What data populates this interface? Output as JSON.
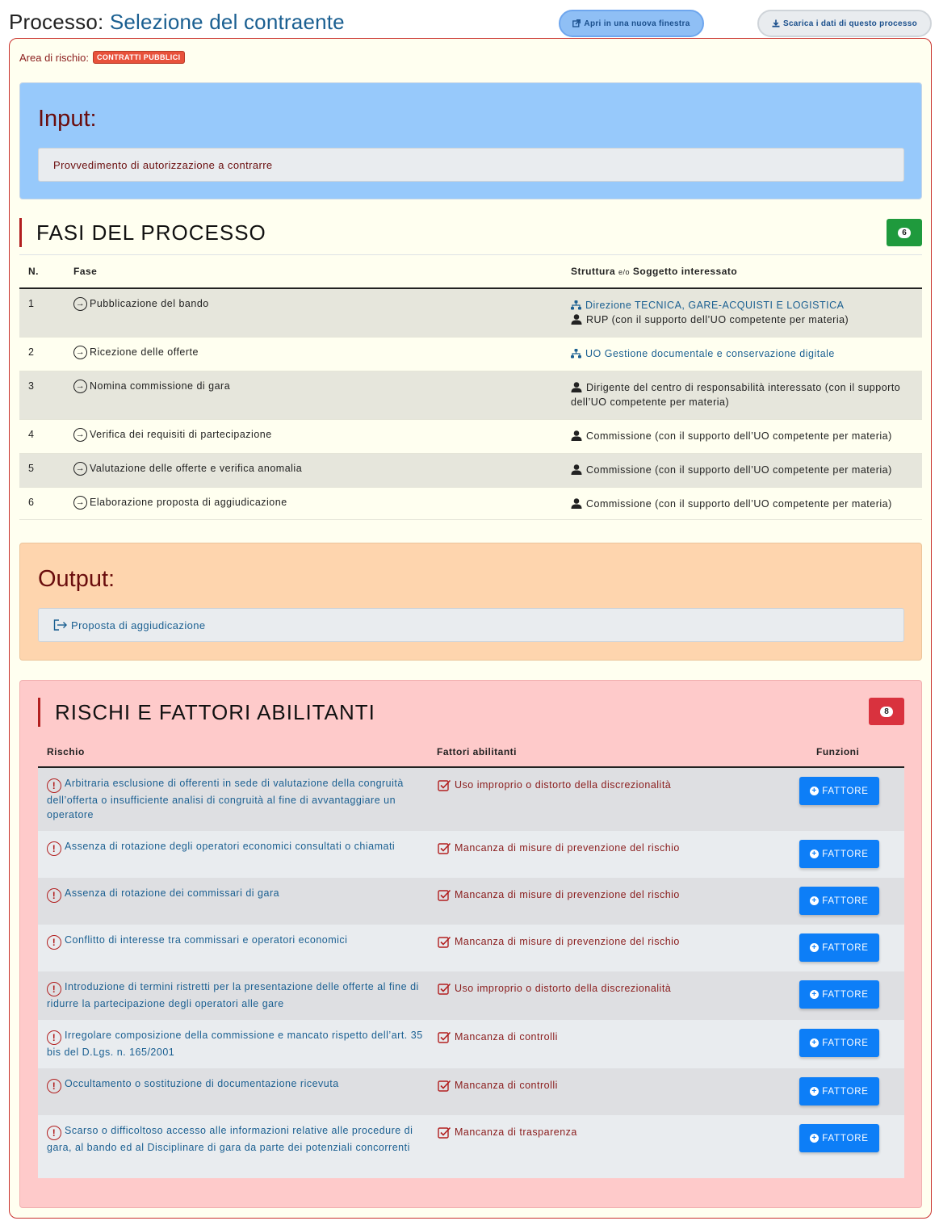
{
  "header": {
    "title_prefix": "Processo:",
    "process_name": "Selezione del contraente",
    "open_new_window_label": "Apri in una nuova finestra",
    "download_label": "Scarica i dati di questo processo"
  },
  "risk_area": {
    "label": "Area di rischio:",
    "value": "CONTRATTI PUBBLICI"
  },
  "input": {
    "title": "Input:",
    "value": "Provvedimento di autorizzazione a contrarre"
  },
  "phases": {
    "title": "FASI DEL PROCESSO",
    "count": "6",
    "col_n": "N.",
    "col_fase": "Fase",
    "col_struttura": "Struttura",
    "col_eo": "e/o",
    "col_soggetto": "Soggetto interessato",
    "rows": [
      {
        "n": "1",
        "fase": "Pubblicazione del bando",
        "org": "Direzione TECNICA, GARE-ACQUISTI E LOGISTICA",
        "person": "RUP (con il supporto dell’UO competente per materia)"
      },
      {
        "n": "2",
        "fase": "Ricezione delle offerte",
        "org": "UO Gestione documentale e conservazione digitale",
        "person": ""
      },
      {
        "n": "3",
        "fase": "Nomina commissione di gara",
        "org": "",
        "person": "Dirigente del centro di responsabilità interessato (con il supporto dell’UO competente per materia)"
      },
      {
        "n": "4",
        "fase": "Verifica dei requisiti di partecipazione",
        "org": "",
        "person": "Commissione (con il supporto dell’UO competente per materia)"
      },
      {
        "n": "5",
        "fase": "Valutazione delle offerte e verifica anomalia",
        "org": "",
        "person": "Commissione (con il supporto dell’UO competente per materia)"
      },
      {
        "n": "6",
        "fase": "Elaborazione proposta di aggiudicazione",
        "org": "",
        "person": "Commissione (con il supporto dell’UO competente per materia)"
      }
    ]
  },
  "output": {
    "title": "Output:",
    "value": "Proposta di aggiudicazione"
  },
  "risks": {
    "title": "RISCHI E FATTORI ABILITANTI",
    "count": "8",
    "col_rischio": "Rischio",
    "col_fattori": "Fattori abilitanti",
    "col_funzioni": "Funzioni",
    "button_label": "FATTORE",
    "rows": [
      {
        "rischio": "Arbitraria esclusione di offerenti in sede di valutazione della congruità dell’offerta o insufficiente analisi di congruità al fine di avvantaggiare un operatore",
        "fattore": "Uso improprio o distorto della discrezionalità"
      },
      {
        "rischio": "Assenza di rotazione degli operatori economici consultati o chiamati",
        "fattore": "Mancanza di misure di prevenzione del rischio"
      },
      {
        "rischio": "Assenza di rotazione dei commissari di gara",
        "fattore": "Mancanza di misure di prevenzione del rischio"
      },
      {
        "rischio": "Conflitto di interesse tra commissari e operatori economici",
        "fattore": "Mancanza di misure di prevenzione del rischio"
      },
      {
        "rischio": "Introduzione di termini ristretti per la presentazione delle offerte al fine di ridurre la partecipazione degli operatori alle gare",
        "fattore": "Uso improprio o distorto della discrezionalità"
      },
      {
        "rischio": "Irregolare composizione della commissione e mancato rispetto dell’art. 35 bis del D.Lgs. n. 165/2001",
        "fattore": "Mancanza di controlli"
      },
      {
        "rischio": "Occultamento o sostituzione di documentazione ricevuta",
        "fattore": "Mancanza di controlli"
      },
      {
        "rischio": "Scarso o difficoltoso accesso alle informazioni relative alle procedure di gara, al bando ed al Disciplinare di gara da parte dei potenziali concorrenti",
        "fattore": "Mancanza di trasparenza"
      }
    ]
  },
  "icons": {
    "phase": "circle-arrow-right-icon",
    "org": "sitemap-icon",
    "person": "user-icon",
    "risk": "exclamation-circle-icon",
    "factor": "check-square-icon",
    "output": "sign-out-icon",
    "add": "plus-circle-icon"
  },
  "colors": {
    "input_bg": "#97c9fb",
    "output_bg": "#fed5ae",
    "risks_bg": "#fecaca",
    "frame_border": "#c9302c",
    "link": "#1a5f91",
    "button": "#0d7ef7"
  }
}
